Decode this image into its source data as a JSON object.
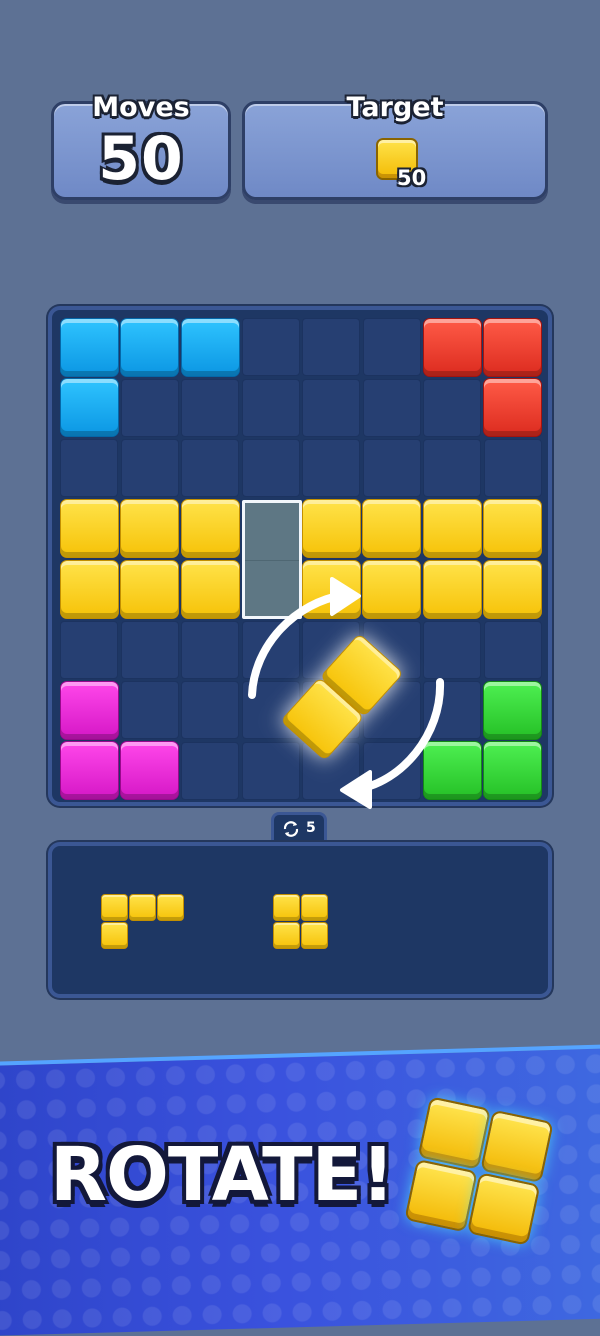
{
  "hud": {
    "moves_label": "Moves",
    "moves_value": "50",
    "target_label": "Target",
    "target_icon": "yellow-block-icon",
    "target_count": "50"
  },
  "board": {
    "rows": 8,
    "cols": 8,
    "colors": {
      "Y": "#f6c207",
      "B": "#0b96e3",
      "R": "#dc2b1f",
      "M": "#d517c6",
      "G": "#25c026",
      "empty": "#263f72"
    },
    "grid": [
      "BBB...RR",
      "B......R",
      "........",
      "YYY.YYYY",
      "YYY.YYYY",
      "........",
      "M......G",
      "MM....GG"
    ],
    "ghost_slot": {
      "row": 3,
      "col": 3,
      "length": 2,
      "orientation": "vertical"
    },
    "active_piece": {
      "color": "yellow",
      "cells": 2,
      "state": "rotating"
    }
  },
  "rotation_counter": {
    "icon": "rotate-icon",
    "value": "5"
  },
  "tray": {
    "pieces": [
      {
        "name": "l-piece",
        "cells": [
          [
            0,
            0
          ],
          [
            0,
            1
          ],
          [
            0,
            2
          ],
          [
            1,
            0
          ]
        ]
      },
      {
        "name": "square-piece",
        "cells": [
          [
            0,
            0
          ],
          [
            0,
            1
          ],
          [
            1,
            0
          ],
          [
            1,
            1
          ]
        ]
      }
    ]
  },
  "banner": {
    "text": "ROTATE!",
    "icon": "yellow-square-piece-icon"
  }
}
